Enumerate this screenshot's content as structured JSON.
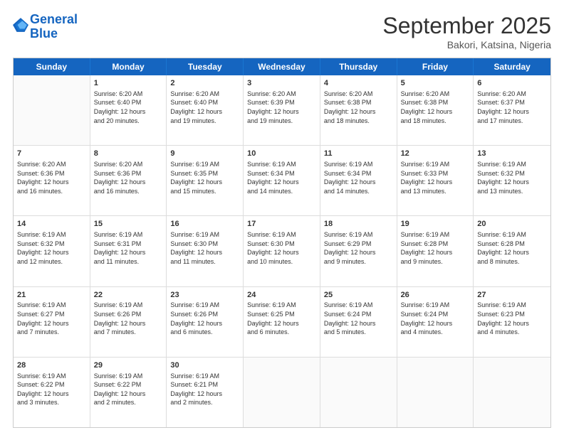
{
  "logo": {
    "line1": "General",
    "line2": "Blue"
  },
  "header": {
    "month": "September 2025",
    "location": "Bakori, Katsina, Nigeria"
  },
  "days": [
    "Sunday",
    "Monday",
    "Tuesday",
    "Wednesday",
    "Thursday",
    "Friday",
    "Saturday"
  ],
  "rows": [
    [
      {
        "num": "",
        "info": ""
      },
      {
        "num": "1",
        "info": "Sunrise: 6:20 AM\nSunset: 6:40 PM\nDaylight: 12 hours\nand 20 minutes."
      },
      {
        "num": "2",
        "info": "Sunrise: 6:20 AM\nSunset: 6:40 PM\nDaylight: 12 hours\nand 19 minutes."
      },
      {
        "num": "3",
        "info": "Sunrise: 6:20 AM\nSunset: 6:39 PM\nDaylight: 12 hours\nand 19 minutes."
      },
      {
        "num": "4",
        "info": "Sunrise: 6:20 AM\nSunset: 6:38 PM\nDaylight: 12 hours\nand 18 minutes."
      },
      {
        "num": "5",
        "info": "Sunrise: 6:20 AM\nSunset: 6:38 PM\nDaylight: 12 hours\nand 18 minutes."
      },
      {
        "num": "6",
        "info": "Sunrise: 6:20 AM\nSunset: 6:37 PM\nDaylight: 12 hours\nand 17 minutes."
      }
    ],
    [
      {
        "num": "7",
        "info": "Sunrise: 6:20 AM\nSunset: 6:36 PM\nDaylight: 12 hours\nand 16 minutes."
      },
      {
        "num": "8",
        "info": "Sunrise: 6:20 AM\nSunset: 6:36 PM\nDaylight: 12 hours\nand 16 minutes."
      },
      {
        "num": "9",
        "info": "Sunrise: 6:19 AM\nSunset: 6:35 PM\nDaylight: 12 hours\nand 15 minutes."
      },
      {
        "num": "10",
        "info": "Sunrise: 6:19 AM\nSunset: 6:34 PM\nDaylight: 12 hours\nand 14 minutes."
      },
      {
        "num": "11",
        "info": "Sunrise: 6:19 AM\nSunset: 6:34 PM\nDaylight: 12 hours\nand 14 minutes."
      },
      {
        "num": "12",
        "info": "Sunrise: 6:19 AM\nSunset: 6:33 PM\nDaylight: 12 hours\nand 13 minutes."
      },
      {
        "num": "13",
        "info": "Sunrise: 6:19 AM\nSunset: 6:32 PM\nDaylight: 12 hours\nand 13 minutes."
      }
    ],
    [
      {
        "num": "14",
        "info": "Sunrise: 6:19 AM\nSunset: 6:32 PM\nDaylight: 12 hours\nand 12 minutes."
      },
      {
        "num": "15",
        "info": "Sunrise: 6:19 AM\nSunset: 6:31 PM\nDaylight: 12 hours\nand 11 minutes."
      },
      {
        "num": "16",
        "info": "Sunrise: 6:19 AM\nSunset: 6:30 PM\nDaylight: 12 hours\nand 11 minutes."
      },
      {
        "num": "17",
        "info": "Sunrise: 6:19 AM\nSunset: 6:30 PM\nDaylight: 12 hours\nand 10 minutes."
      },
      {
        "num": "18",
        "info": "Sunrise: 6:19 AM\nSunset: 6:29 PM\nDaylight: 12 hours\nand 9 minutes."
      },
      {
        "num": "19",
        "info": "Sunrise: 6:19 AM\nSunset: 6:28 PM\nDaylight: 12 hours\nand 9 minutes."
      },
      {
        "num": "20",
        "info": "Sunrise: 6:19 AM\nSunset: 6:28 PM\nDaylight: 12 hours\nand 8 minutes."
      }
    ],
    [
      {
        "num": "21",
        "info": "Sunrise: 6:19 AM\nSunset: 6:27 PM\nDaylight: 12 hours\nand 7 minutes."
      },
      {
        "num": "22",
        "info": "Sunrise: 6:19 AM\nSunset: 6:26 PM\nDaylight: 12 hours\nand 7 minutes."
      },
      {
        "num": "23",
        "info": "Sunrise: 6:19 AM\nSunset: 6:26 PM\nDaylight: 12 hours\nand 6 minutes."
      },
      {
        "num": "24",
        "info": "Sunrise: 6:19 AM\nSunset: 6:25 PM\nDaylight: 12 hours\nand 6 minutes."
      },
      {
        "num": "25",
        "info": "Sunrise: 6:19 AM\nSunset: 6:24 PM\nDaylight: 12 hours\nand 5 minutes."
      },
      {
        "num": "26",
        "info": "Sunrise: 6:19 AM\nSunset: 6:24 PM\nDaylight: 12 hours\nand 4 minutes."
      },
      {
        "num": "27",
        "info": "Sunrise: 6:19 AM\nSunset: 6:23 PM\nDaylight: 12 hours\nand 4 minutes."
      }
    ],
    [
      {
        "num": "28",
        "info": "Sunrise: 6:19 AM\nSunset: 6:22 PM\nDaylight: 12 hours\nand 3 minutes."
      },
      {
        "num": "29",
        "info": "Sunrise: 6:19 AM\nSunset: 6:22 PM\nDaylight: 12 hours\nand 2 minutes."
      },
      {
        "num": "30",
        "info": "Sunrise: 6:19 AM\nSunset: 6:21 PM\nDaylight: 12 hours\nand 2 minutes."
      },
      {
        "num": "",
        "info": ""
      },
      {
        "num": "",
        "info": ""
      },
      {
        "num": "",
        "info": ""
      },
      {
        "num": "",
        "info": ""
      }
    ]
  ]
}
